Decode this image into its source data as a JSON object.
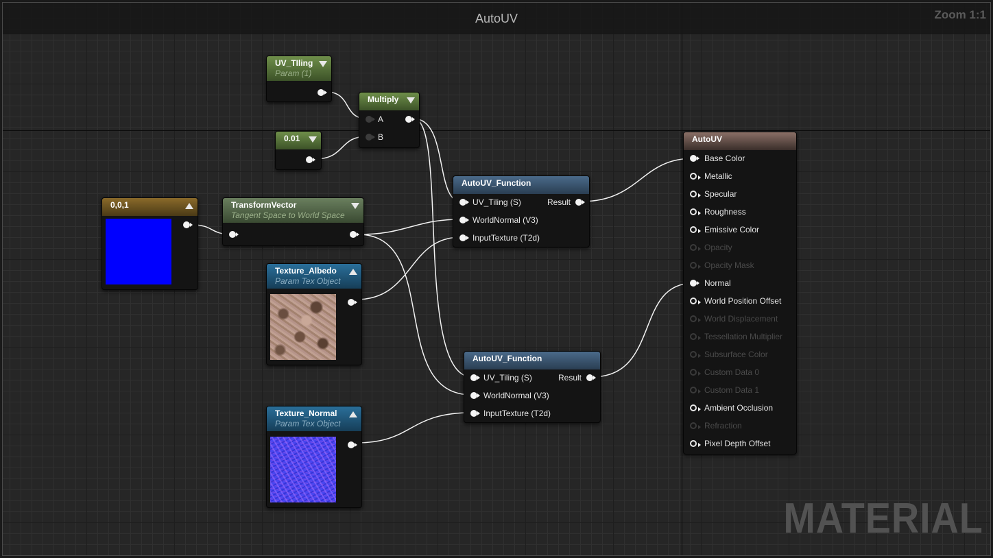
{
  "window": {
    "title": "AutoUV",
    "zoom": "Zoom 1:1",
    "watermark": "MATERIAL"
  },
  "nodes": {
    "uv_tiling": {
      "title": "UV_TIling",
      "subtitle": "Param (1)"
    },
    "multiply": {
      "title": "Multiply",
      "input_a": "A",
      "input_b": "B"
    },
    "const_001": {
      "title": "0.01"
    },
    "vec_001": {
      "title": "0,0,1",
      "swatch_color": "#0000ff"
    },
    "transform_vector": {
      "title": "TransformVector",
      "subtitle": "Tangent Space to World Space"
    },
    "texture_albedo": {
      "title": "Texture_Albedo",
      "subtitle": "Param Tex Object"
    },
    "texture_normal": {
      "title": "Texture_Normal",
      "subtitle": "Param Tex Object"
    },
    "autouv_function_1": {
      "title": "AutoUV_Function",
      "inputs": [
        "UV_Tiling (S)",
        "WorldNormal (V3)",
        "InputTexture (T2d)"
      ],
      "output": "Result"
    },
    "autouv_function_2": {
      "title": "AutoUV_Function",
      "inputs": [
        "UV_Tiling (S)",
        "WorldNormal (V3)",
        "InputTexture (T2d)"
      ],
      "output": "Result"
    },
    "material_output": {
      "title": "AutoUV",
      "inputs": [
        {
          "label": "Base Color",
          "state": "connected"
        },
        {
          "label": "Metallic",
          "state": "enabled"
        },
        {
          "label": "Specular",
          "state": "enabled"
        },
        {
          "label": "Roughness",
          "state": "enabled"
        },
        {
          "label": "Emissive Color",
          "state": "enabled"
        },
        {
          "label": "Opacity",
          "state": "disabled"
        },
        {
          "label": "Opacity Mask",
          "state": "disabled"
        },
        {
          "label": "Normal",
          "state": "connected"
        },
        {
          "label": "World Position Offset",
          "state": "enabled"
        },
        {
          "label": "World Displacement",
          "state": "disabled"
        },
        {
          "label": "Tessellation Multiplier",
          "state": "disabled"
        },
        {
          "label": "Subsurface Color",
          "state": "disabled"
        },
        {
          "label": "Custom Data 0",
          "state": "disabled"
        },
        {
          "label": "Custom Data 1",
          "state": "disabled"
        },
        {
          "label": "Ambient Occlusion",
          "state": "enabled"
        },
        {
          "label": "Refraction",
          "state": "disabled"
        },
        {
          "label": "Pixel Depth Offset",
          "state": "enabled"
        }
      ]
    }
  }
}
